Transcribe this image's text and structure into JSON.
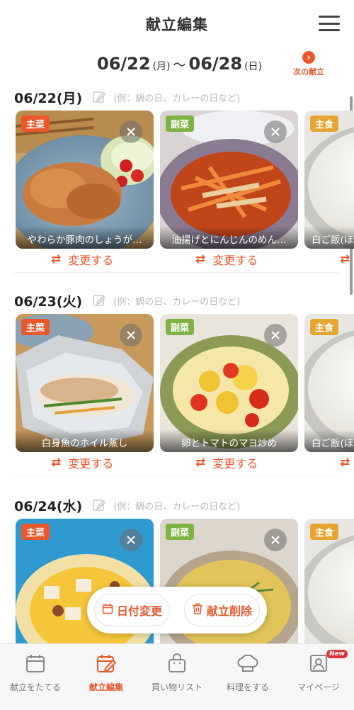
{
  "header": {
    "title": "献立編集"
  },
  "week": {
    "start_date": "06/22",
    "start_dow": "(月)",
    "separator": "～",
    "end_date": "06/28",
    "end_dow": "(日)",
    "next_label": "次の献立"
  },
  "placeholder_note": "(例：鍋の日、カレーの日など)",
  "change_label": "変更する",
  "days": [
    {
      "date": "06/22(月)",
      "dishes": [
        {
          "badge": "主菜",
          "name": "やわらか豚肉のしょうが…"
        },
        {
          "badge": "副菜",
          "name": "油揚げとにんじんのめん…"
        },
        {
          "badge": "主食",
          "name": "白ご飯(ほ"
        }
      ]
    },
    {
      "date": "06/23(火)",
      "dishes": [
        {
          "badge": "主菜",
          "name": "白身魚のホイル蒸し"
        },
        {
          "badge": "副菜",
          "name": "卵とトマトのマヨ炒め"
        },
        {
          "badge": "主食",
          "name": "白ご飯(ほ"
        }
      ]
    },
    {
      "date": "06/24(水)",
      "dishes": [
        {
          "badge": "主菜",
          "name": ""
        },
        {
          "badge": "副菜",
          "name": ""
        },
        {
          "badge": "主食",
          "name": ""
        }
      ]
    }
  ],
  "actions": {
    "change_date": "日付変更",
    "delete_menu": "献立削除"
  },
  "tabs": [
    {
      "label": "献立をたてる",
      "icon": "calendar-icon"
    },
    {
      "label": "献立編集",
      "icon": "edit-calendar-icon"
    },
    {
      "label": "買い物リスト",
      "icon": "shopping-bag-icon"
    },
    {
      "label": "料理をする",
      "icon": "chef-hat-icon"
    },
    {
      "label": "マイページ",
      "icon": "mypage-icon"
    }
  ],
  "new_badge": "New",
  "colors": {
    "accent": "#e9572b",
    "main_badge": "#e9572b",
    "side_badge": "#7cb342",
    "staple_badge": "#e6a532"
  }
}
